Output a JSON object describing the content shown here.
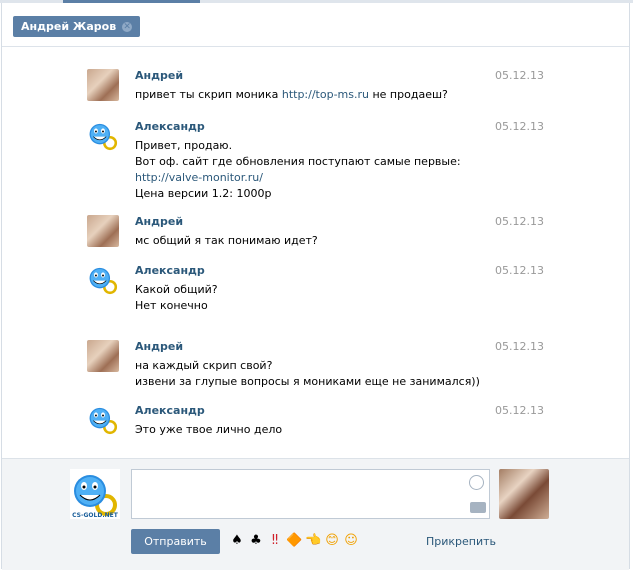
{
  "tab": {
    "title": "Андрей Жаров",
    "close": "✕"
  },
  "messages": [
    {
      "author": "Андрей",
      "avatar": "andrey",
      "date": "05.12.13",
      "lines": [
        [
          "привет ты скрип моника ",
          "http://top-ms.ru",
          " не продаеш?"
        ]
      ]
    },
    {
      "author": "Александр",
      "avatar": "alexandr",
      "date": "05.12.13",
      "lines": [
        [
          "Привет, продаю."
        ],
        [
          "Вот оф. сайт где обновления поступают самые первые:"
        ],
        [
          "",
          "http://valve-monitor.ru/",
          ""
        ],
        [
          "Цена версии 1.2: 1000р"
        ]
      ]
    },
    {
      "author": "Андрей",
      "avatar": "andrey",
      "date": "05.12.13",
      "lines": [
        [
          "мс общий я так понимаю идет?"
        ]
      ]
    },
    {
      "author": "Александр",
      "avatar": "alexandr",
      "date": "05.12.13",
      "lines": [
        [
          "Какой общий?"
        ],
        [
          " "
        ],
        [
          "Нет конечно"
        ]
      ]
    },
    {
      "author": "Андрей",
      "avatar": "andrey",
      "date": "05.12.13",
      "lines": [
        [
          "на каждый скрип свой?"
        ],
        [
          "извени за глупые вопросы я мониками еще не занимался))"
        ]
      ]
    },
    {
      "author": "Александр",
      "avatar": "alexandr",
      "date": "05.12.13",
      "lines": [
        [
          "Это уже твое лично дело"
        ]
      ]
    }
  ],
  "avatar_text": "CS-GOLD.NET",
  "composer": {
    "placeholder": "",
    "send_label": "Отправить",
    "attach_label": "Прикрепить",
    "emojis": [
      "♠",
      "♣",
      "‼",
      "🔶",
      "👈",
      "😊",
      "☺"
    ]
  },
  "colors": {
    "accent": "#5b7fa6",
    "link": "#2b587a",
    "date": "#999999"
  }
}
